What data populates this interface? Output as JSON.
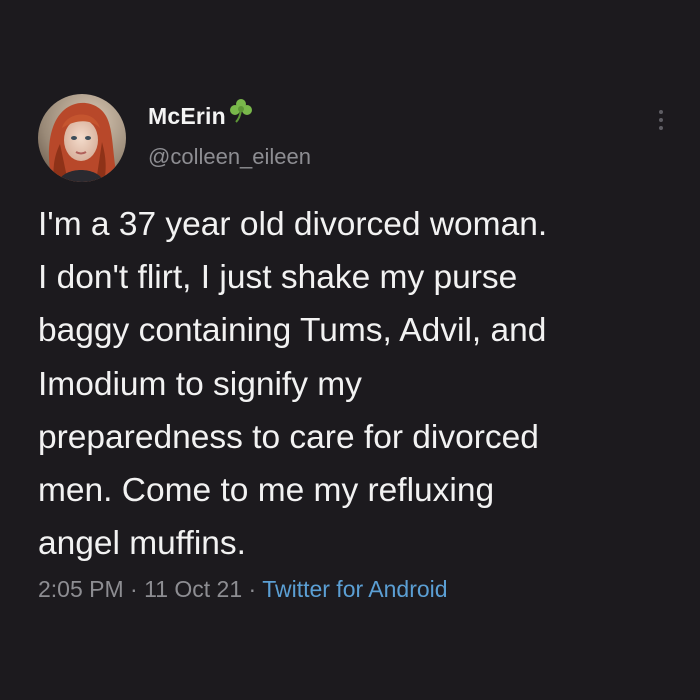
{
  "author": {
    "display_name": "McErin",
    "badge_icon": "shamrock-icon",
    "handle": "@colleen_eileen"
  },
  "tweet": {
    "lines": [
      "I'm a 37 year old divorced woman.",
      "I don't flirt, I just shake my purse",
      "baggy containing Tums, Advil, and",
      "Imodium to signify my",
      "preparedness to care for divorced",
      "men. Come to me my refluxing",
      "angel muffins."
    ],
    "time": "2:05 PM",
    "date": "11 Oct 21",
    "separator": "·",
    "source": "Twitter for Android"
  },
  "colors": {
    "background": "#1c1a1e",
    "text": "#f2f2f2",
    "muted": "#8d8d92",
    "link": "#5b9fd4",
    "shamrock": "#79b84b"
  },
  "icons": {
    "more": "more-vertical-icon",
    "avatar": "profile-photo"
  }
}
